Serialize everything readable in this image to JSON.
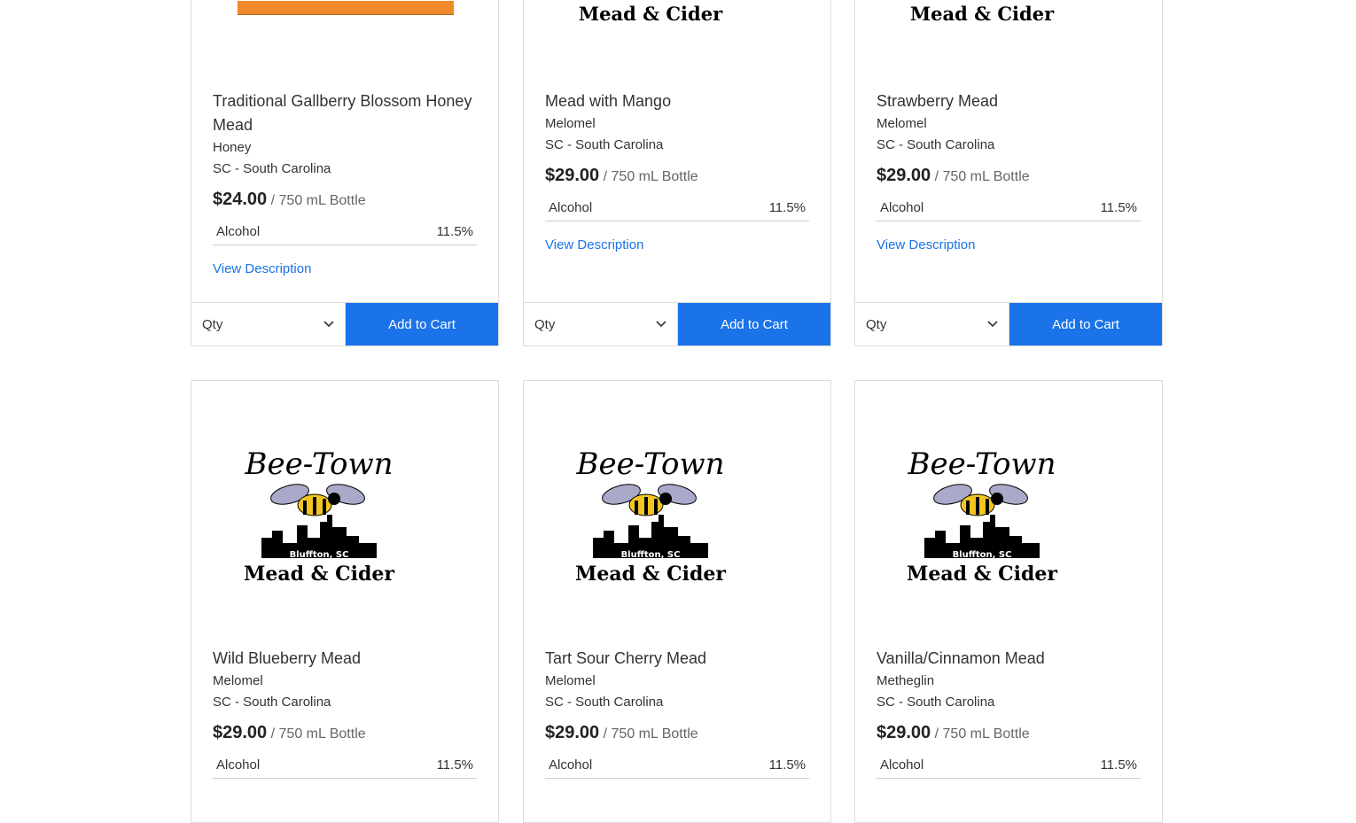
{
  "brand_text": {
    "line1": "Bee-Town",
    "line2": "Bluffton, SC",
    "line3": "Mead & Cider"
  },
  "accent_color": "#1a73e8",
  "products": [
    {
      "title": "Traditional Gallberry Blossom Honey Mead",
      "style": "Honey",
      "region": "SC - South Carolina",
      "price": "$24.00",
      "unit": "/ 750 mL Bottle",
      "spec_label": "Alcohol",
      "spec_value": "11.5%",
      "link": "View Description",
      "qty": "Qty",
      "cart": "Add to Cart"
    },
    {
      "title": "Mead with Mango",
      "style": "Melomel",
      "region": "SC - South Carolina",
      "price": "$29.00",
      "unit": "/ 750 mL Bottle",
      "spec_label": "Alcohol",
      "spec_value": "11.5%",
      "link": "View Description",
      "qty": "Qty",
      "cart": "Add to Cart"
    },
    {
      "title": "Strawberry Mead",
      "style": "Melomel",
      "region": "SC - South Carolina",
      "price": "$29.00",
      "unit": "/ 750 mL Bottle",
      "spec_label": "Alcohol",
      "spec_value": "11.5%",
      "link": "View Description",
      "qty": "Qty",
      "cart": "Add to Cart"
    },
    {
      "title": "Wild Blueberry Mead",
      "style": "Melomel",
      "region": "SC - South Carolina",
      "price": "$29.00",
      "unit": "/ 750 mL Bottle",
      "spec_label": "Alcohol",
      "spec_value": "11.5%"
    },
    {
      "title": "Tart Sour Cherry Mead",
      "style": "Melomel",
      "region": "SC - South Carolina",
      "price": "$29.00",
      "unit": "/ 750 mL Bottle",
      "spec_label": "Alcohol",
      "spec_value": "11.5%"
    },
    {
      "title": "Vanilla/Cinnamon Mead",
      "style": "Metheglin",
      "region": "SC - South Carolina",
      "price": "$29.00",
      "unit": "/ 750 mL Bottle",
      "spec_label": "Alcohol",
      "spec_value": "11.5%"
    }
  ]
}
